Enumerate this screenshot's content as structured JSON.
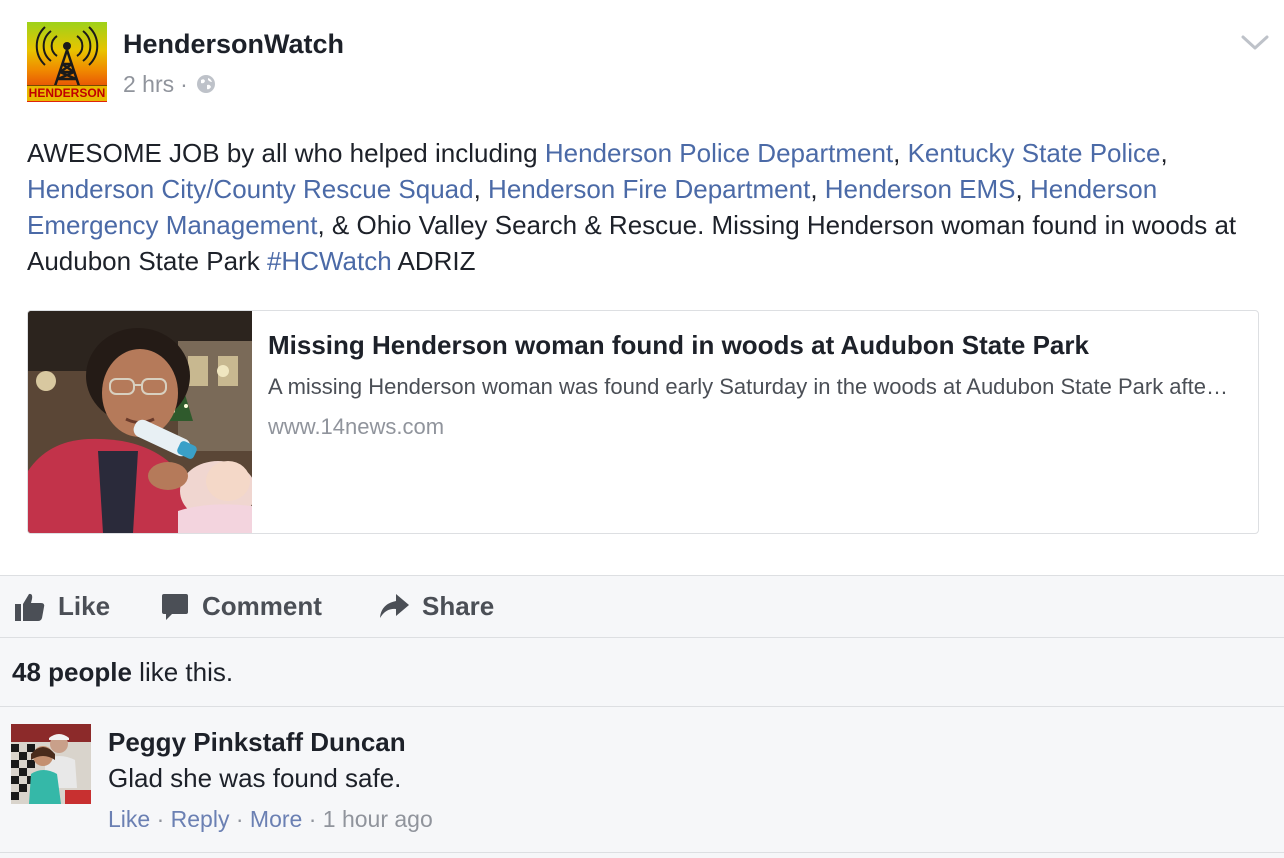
{
  "post": {
    "page_name": "HendersonWatch",
    "avatar_label": "HENDERSON",
    "timestamp": "2 hrs",
    "meta_separator": "·",
    "privacy_icon": "globe-icon",
    "menu_icon": "chevron-down-icon",
    "text_segments": [
      {
        "text": "AWESOME JOB by all who helped including ",
        "link": false
      },
      {
        "text": "Henderson Police Department",
        "link": true
      },
      {
        "text": ", ",
        "link": false
      },
      {
        "text": "Kentucky State Police",
        "link": true
      },
      {
        "text": ", ",
        "link": false
      },
      {
        "text": "Henderson City/County Rescue Squad",
        "link": true
      },
      {
        "text": ", ",
        "link": false
      },
      {
        "text": "Henderson Fire Department",
        "link": true
      },
      {
        "text": ", ",
        "link": false
      },
      {
        "text": "Henderson EMS",
        "link": true
      },
      {
        "text": ", ",
        "link": false
      },
      {
        "text": "Henderson Emergency Management",
        "link": true
      },
      {
        "text": ", & Ohio Valley Search & Rescue. Missing Henderson woman found in woods at Audubon State Park ",
        "link": false
      },
      {
        "text": "#HCWatch",
        "link": true
      },
      {
        "text": " ADRIZ",
        "link": false
      }
    ],
    "link_color": "#4b6aa7"
  },
  "link_card": {
    "title": "Missing Henderson woman found in woods at Audubon State Park",
    "description": "A missing Henderson woman was found early Saturday in the woods at Audubon State Park after she went missing",
    "domain": "www.14news.com"
  },
  "actions": {
    "like_label": "Like",
    "comment_label": "Comment",
    "share_label": "Share",
    "like_icon": "thumbs-up-icon",
    "comment_icon": "speech-bubble-icon",
    "share_icon": "share-arrow-icon"
  },
  "likes": {
    "count_label": "48 people",
    "suffix": " like this."
  },
  "comment": {
    "author": "Peggy Pinkstaff Duncan",
    "text": "Glad she was found safe.",
    "like_label": "Like",
    "reply_label": "Reply",
    "more_label": "More",
    "time": "1 hour ago",
    "separator": " · "
  },
  "colors": {
    "text": "#1d2129",
    "secondary": "#90949c",
    "link": "#4b6aa7",
    "bar_bg": "#f6f7f9",
    "divider": "#dddfe2"
  }
}
